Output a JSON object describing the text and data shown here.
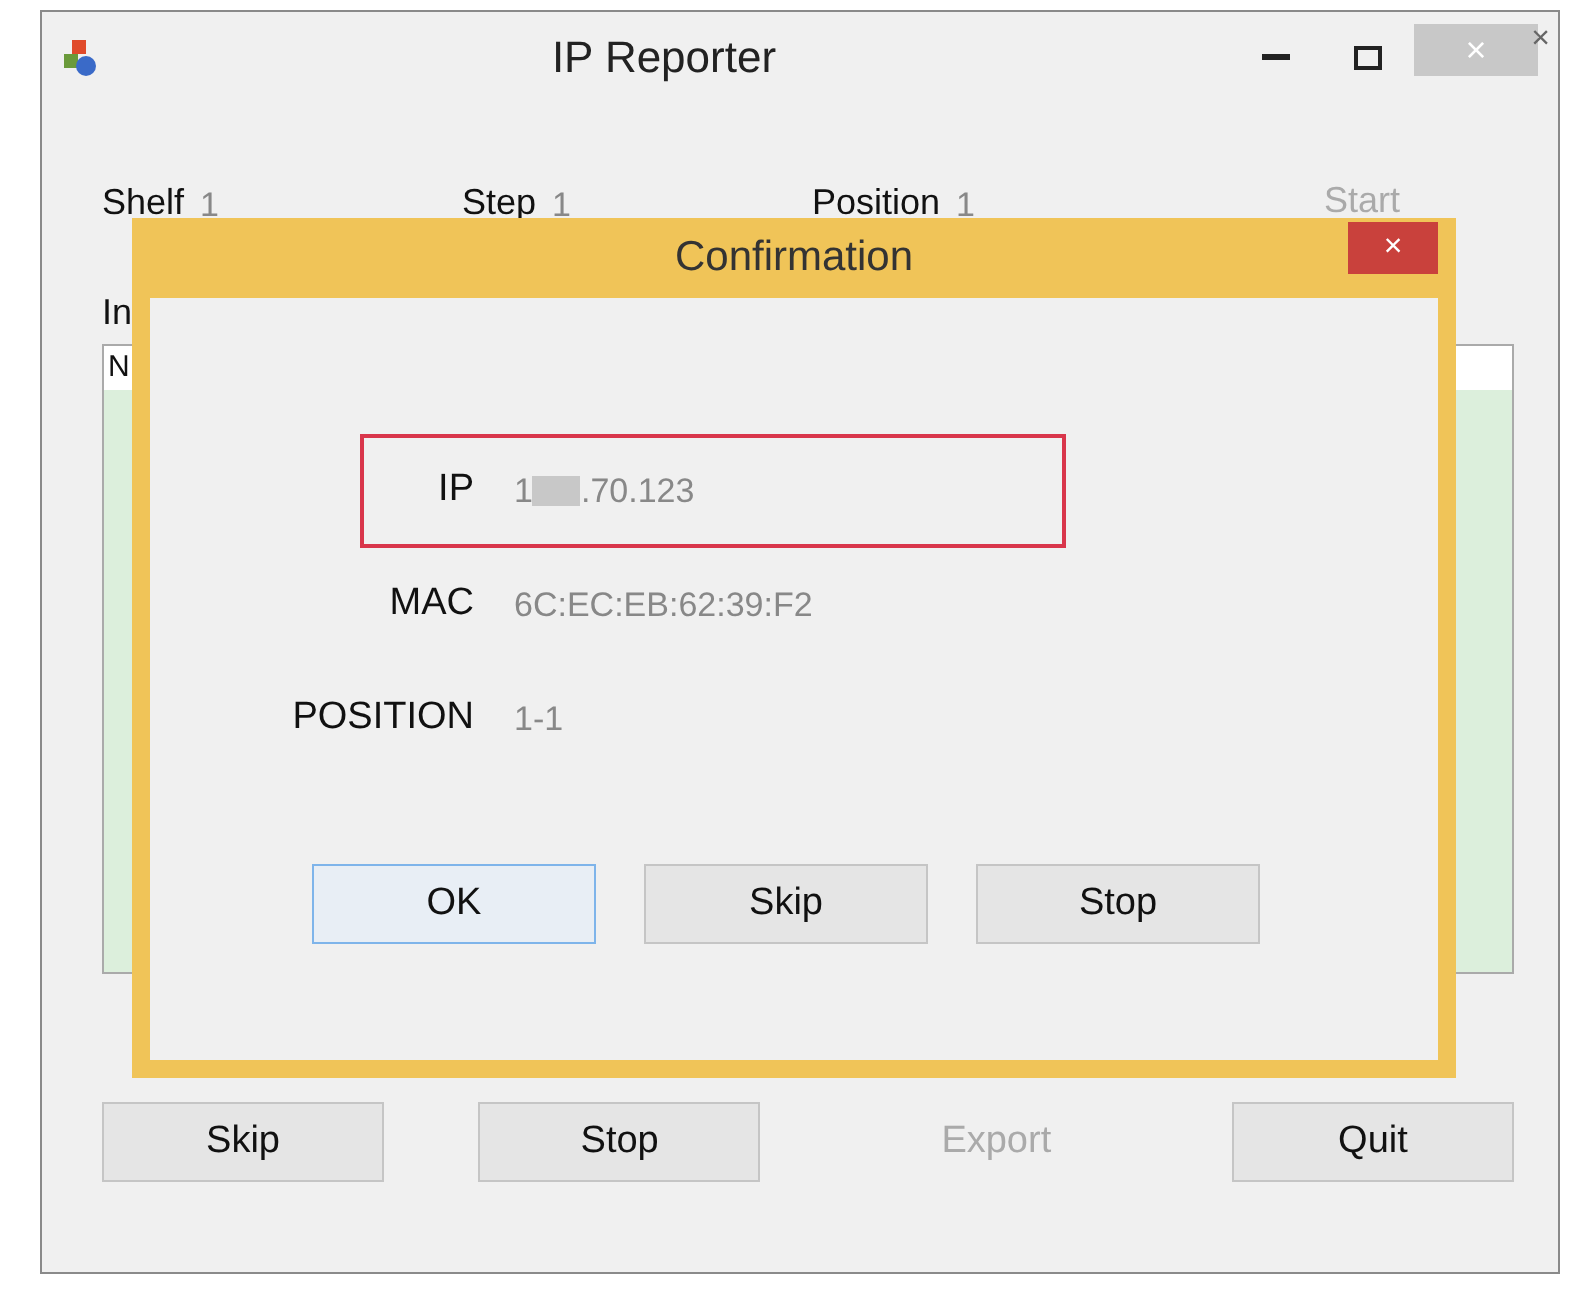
{
  "window": {
    "title": "IP Reporter",
    "close": "×",
    "outer_close": "×"
  },
  "fields": [
    {
      "label": "Shelf",
      "value": "1"
    },
    {
      "label": "Step",
      "value": "1"
    },
    {
      "label": "Position",
      "value": "1"
    }
  ],
  "start_button": {
    "label": "Start",
    "disabled": true
  },
  "list_label": "In",
  "list": {
    "header": "N"
  },
  "buttons": [
    {
      "label": "Skip",
      "disabled": false
    },
    {
      "label": "Stop",
      "disabled": false
    },
    {
      "label": "Export",
      "disabled": true
    },
    {
      "label": "Quit",
      "disabled": false
    }
  ],
  "dialog": {
    "title": "Confirmation",
    "close": "×",
    "rows": [
      {
        "label": "IP",
        "value_parts": [
          "1",
          ".70.123"
        ],
        "highlighted": true
      },
      {
        "label": "MAC",
        "value": "6C:EC:EB:62:39:F2",
        "highlighted": false
      },
      {
        "label": "POSITION",
        "value": "1-1",
        "highlighted": false
      }
    ],
    "buttons": [
      {
        "label": "OK",
        "focused": true
      },
      {
        "label": "Skip",
        "focused": false
      },
      {
        "label": "Stop",
        "focused": false
      }
    ]
  }
}
